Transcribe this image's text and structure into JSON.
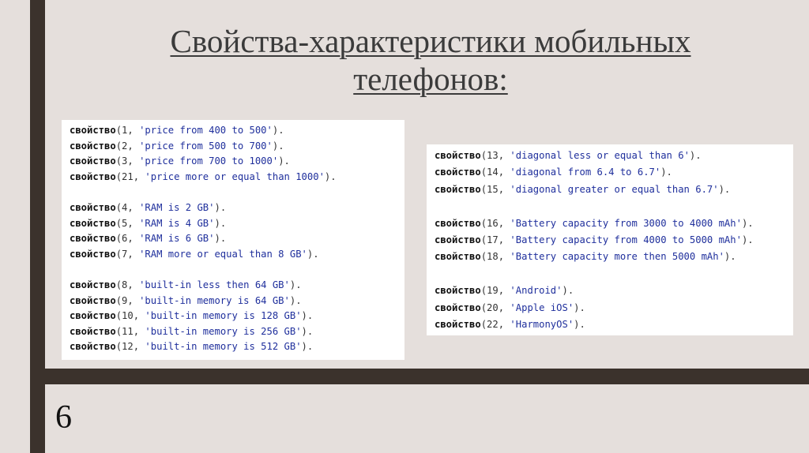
{
  "title": "Свойства-характеристики мобильных телефонов:",
  "page_number": "6",
  "keyword": "свойство",
  "left_groups": [
    [
      {
        "n": "1",
        "s": "price from 400 to 500"
      },
      {
        "n": "2",
        "s": "price from 500 to 700"
      },
      {
        "n": "3",
        "s": "price from 700 to 1000"
      },
      {
        "n": "21",
        "s": "price more or equal than 1000"
      }
    ],
    [
      {
        "n": "4",
        "s": "RAM is 2 GB"
      },
      {
        "n": "5",
        "s": "RAM is 4 GB"
      },
      {
        "n": "6",
        "s": "RAM is 6 GB"
      },
      {
        "n": "7",
        "s": "RAM more or equal than 8 GB"
      }
    ],
    [
      {
        "n": "8",
        "s": "built-in less then 64 GB"
      },
      {
        "n": "9",
        "s": "built-in memory is 64 GB"
      },
      {
        "n": "10",
        "s": "built-in memory is 128 GB"
      },
      {
        "n": "11",
        "s": "built-in memory is 256 GB"
      },
      {
        "n": "12",
        "s": "built-in memory is 512 GB"
      }
    ]
  ],
  "right_groups": [
    [
      {
        "n": "13",
        "s": "diagonal less or equal than 6"
      },
      {
        "n": "14",
        "s": "diagonal from 6.4 to 6.7"
      },
      {
        "n": "15",
        "s": "diagonal greater or equal than 6.7"
      }
    ],
    [
      {
        "n": "16",
        "s": "Battery capacity from 3000 to 4000 mAh"
      },
      {
        "n": "17",
        "s": "Battery capacity from 4000 to 5000 mAh"
      },
      {
        "n": "18",
        "s": "Battery capacity more then 5000 mAh"
      }
    ],
    [
      {
        "n": "19",
        "s": "Android"
      },
      {
        "n": "20",
        "s": "Apple iOS"
      },
      {
        "n": "22",
        "s": "HarmonyOS"
      }
    ]
  ]
}
